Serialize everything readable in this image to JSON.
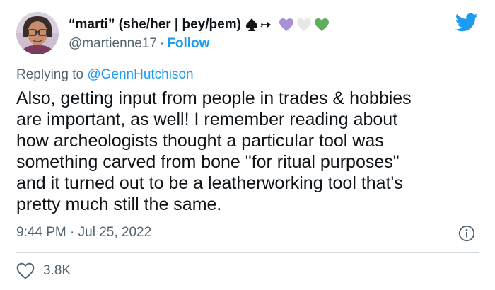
{
  "author": {
    "display_name": "“marti” (she/her | þey/þem)",
    "handle": "@martienne17",
    "separator": "·",
    "follow_label": "Follow"
  },
  "reply": {
    "prefix": "Replying to ",
    "target": "@GennHutchison"
  },
  "tweet": {
    "lines": [
      "Also, getting input from people in trades & hobbies",
      "are important, as well! I remember reading about",
      "how archeologists thought a particular tool was",
      "something carved from bone \"for ritual purposes\"",
      "and it turned out to be a leatherworking tool that's",
      "pretty much still the same."
    ]
  },
  "meta": {
    "time": "9:44 PM",
    "separator": "·",
    "date": "Jul 25, 2022"
  },
  "engagement": {
    "likes": "3.8K"
  },
  "colors": {
    "accent": "#1d9bf0",
    "muted": "#536471",
    "text": "#0f1419",
    "heart_purple": "#a98fd6",
    "heart_white": "#e8e8e8",
    "heart_green": "#5fae5a"
  },
  "icons": {
    "twitter": "twitter-bird-icon",
    "info": "info-icon",
    "like": "heart-outline-icon",
    "emoji_spade": "spade-icon",
    "emoji_arrow": "arrow-icon"
  }
}
